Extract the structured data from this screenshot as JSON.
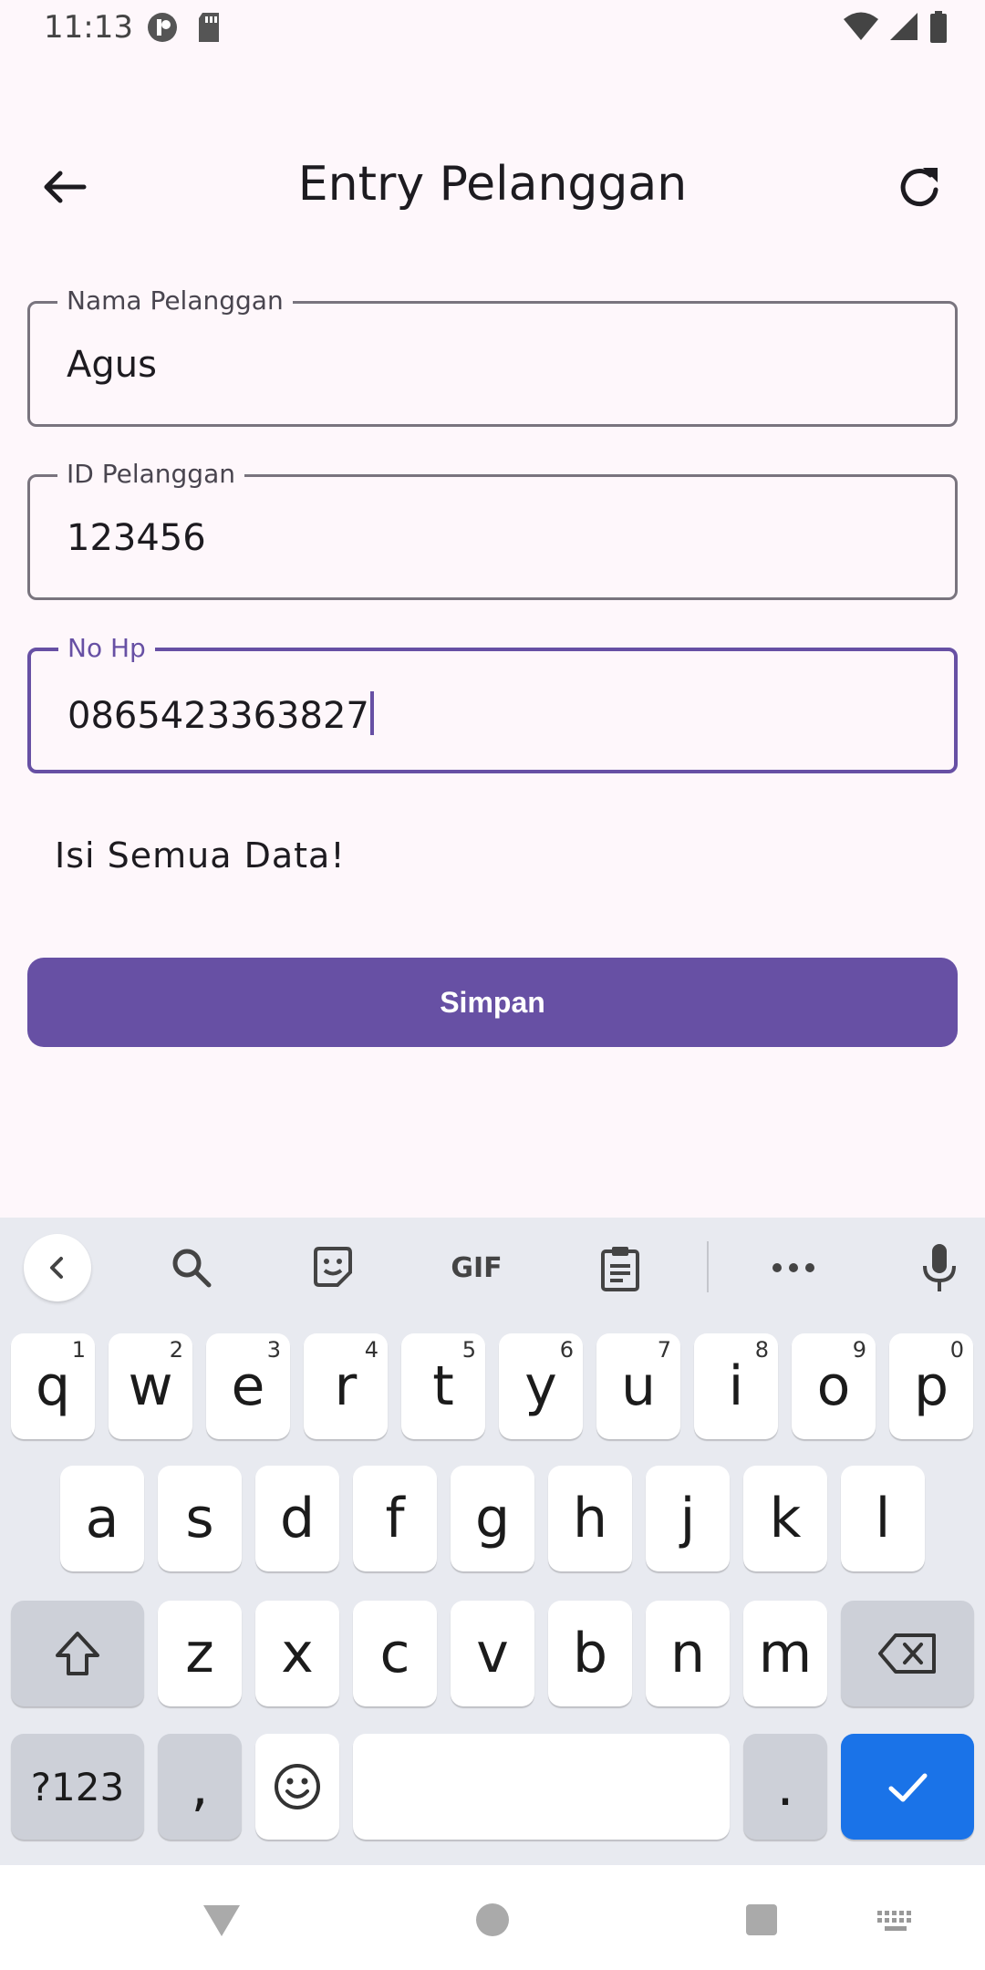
{
  "status_bar": {
    "time": "11:13"
  },
  "app_bar": {
    "title": "Entry Pelanggan"
  },
  "form": {
    "fields": [
      {
        "label": "Nama Pelanggan",
        "value": "Agus"
      },
      {
        "label": "ID Pelanggan",
        "value": "123456"
      },
      {
        "label": "No Hp",
        "value": "0865423363827"
      }
    ],
    "message": "Isi Semua Data!",
    "save_label": "Simpan"
  },
  "colors": {
    "primary": "#6750a4",
    "keyboard_enter": "#1a73e8"
  },
  "keyboard": {
    "toolbar_gif": "GIF",
    "row1": [
      {
        "k": "q",
        "h": "1"
      },
      {
        "k": "w",
        "h": "2"
      },
      {
        "k": "e",
        "h": "3"
      },
      {
        "k": "r",
        "h": "4"
      },
      {
        "k": "t",
        "h": "5"
      },
      {
        "k": "y",
        "h": "6"
      },
      {
        "k": "u",
        "h": "7"
      },
      {
        "k": "i",
        "h": "8"
      },
      {
        "k": "o",
        "h": "9"
      },
      {
        "k": "p",
        "h": "0"
      }
    ],
    "row2": [
      "a",
      "s",
      "d",
      "f",
      "g",
      "h",
      "j",
      "k",
      "l"
    ],
    "row3": [
      "z",
      "x",
      "c",
      "v",
      "b",
      "n",
      "m"
    ],
    "symbols_label": "?123",
    "comma_label": ",",
    "period_label": "."
  }
}
